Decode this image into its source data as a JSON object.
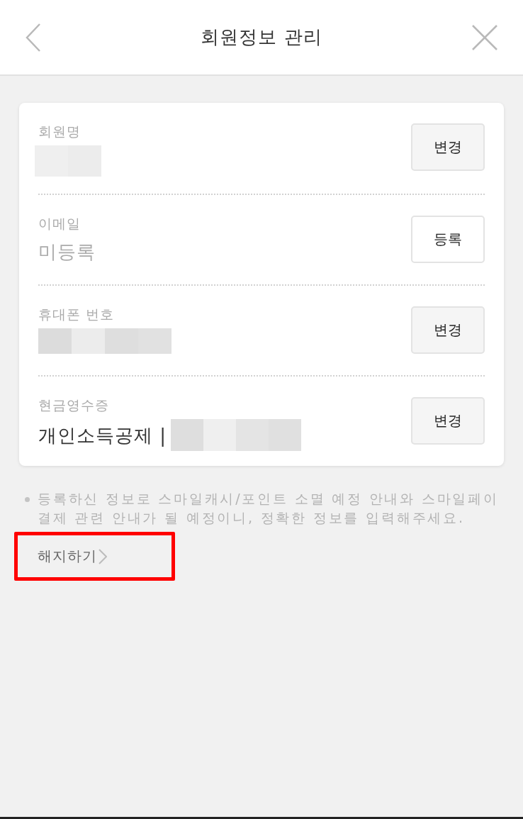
{
  "header": {
    "title": "회원정보 관리"
  },
  "fields": [
    {
      "label": "회원명",
      "kind": "masked_short",
      "button": {
        "label": "변경",
        "kind": "filled"
      }
    },
    {
      "label": "이메일",
      "kind": "text",
      "value": "미등록",
      "muted": true,
      "button": {
        "label": "등록",
        "kind": "outline"
      }
    },
    {
      "label": "휴대폰 번호",
      "kind": "masked_long",
      "button": {
        "label": "변경",
        "kind": "filled"
      }
    },
    {
      "label": "현금영수증",
      "kind": "text_masked",
      "value": "개인소득공제 |",
      "muted": false,
      "button": {
        "label": "변경",
        "kind": "filled"
      }
    }
  ],
  "notice": {
    "text": "등록하신 정보로 스마일캐시/포인트 소멸 예정 안내와 스마일페이 결제 관련 안내가 될 예정이니, 정확한 정보를 입력해주세요."
  },
  "terminate_link": {
    "label": "해지하기",
    "highlighted": true
  }
}
